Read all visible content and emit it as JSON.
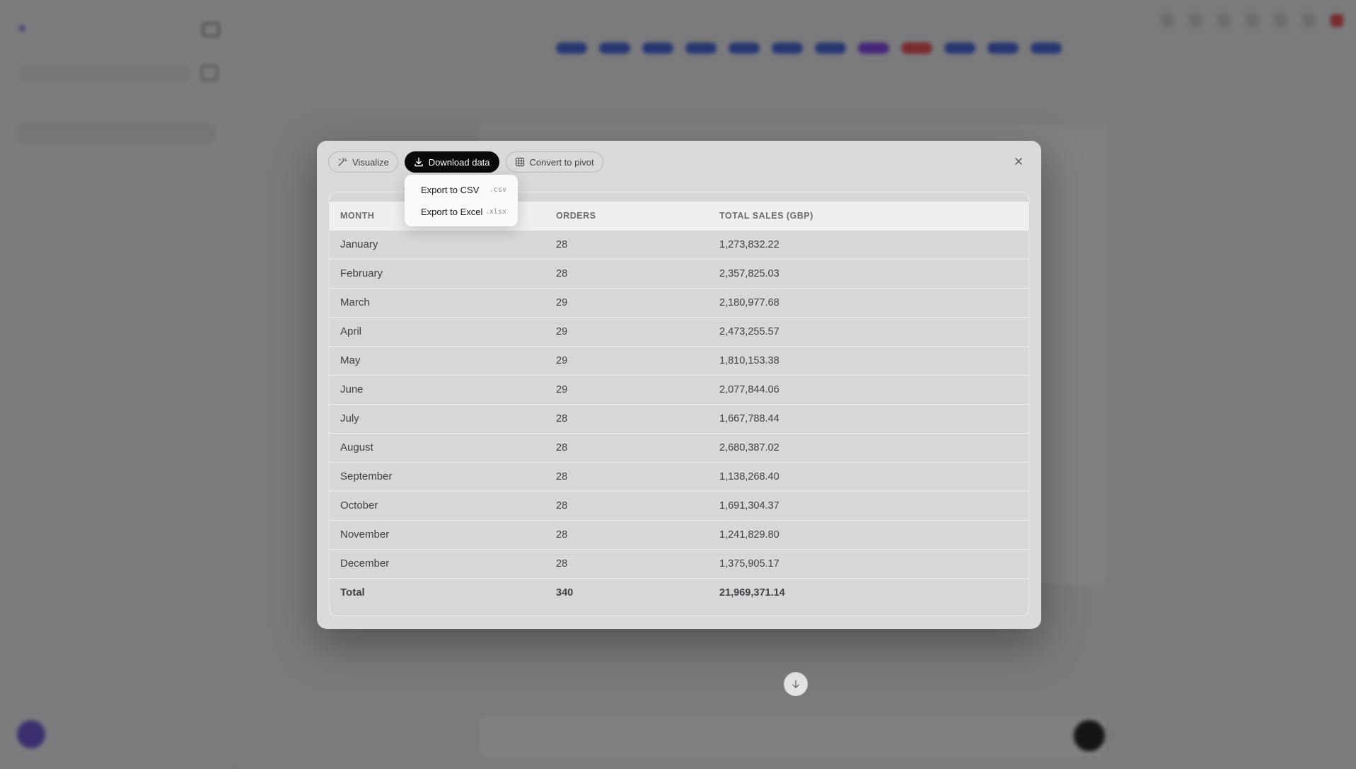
{
  "modal": {
    "toolbar": {
      "visualize_label": "Visualize",
      "download_label": "Download data",
      "pivot_label": "Convert to pivot"
    },
    "download_menu": [
      {
        "label": "Export to CSV",
        "ext": ".csv"
      },
      {
        "label": "Export to Excel",
        "ext": ".xlsx"
      }
    ],
    "table": {
      "columns": [
        "MONTH",
        "ORDERS",
        "TOTAL SALES (GBP)"
      ],
      "rows": [
        [
          "January",
          "28",
          "1,273,832.22"
        ],
        [
          "February",
          "28",
          "2,357,825.03"
        ],
        [
          "March",
          "29",
          "2,180,977.68"
        ],
        [
          "April",
          "29",
          "2,473,255.57"
        ],
        [
          "May",
          "29",
          "1,810,153.38"
        ],
        [
          "June",
          "29",
          "2,077,844.06"
        ],
        [
          "July",
          "28",
          "1,667,788.44"
        ],
        [
          "August",
          "28",
          "2,680,387.02"
        ],
        [
          "September",
          "28",
          "1,138,268.40"
        ],
        [
          "October",
          "28",
          "1,691,304.37"
        ],
        [
          "November",
          "28",
          "1,241,829.80"
        ],
        [
          "December",
          "28",
          "1,375,905.17"
        ]
      ],
      "total": [
        "Total",
        "340",
        "21,969,371.14"
      ]
    }
  },
  "colors": {
    "primary_button": "#0a0a0a",
    "overlay": "#18181b",
    "accent_purple": "#8b5cf6"
  }
}
